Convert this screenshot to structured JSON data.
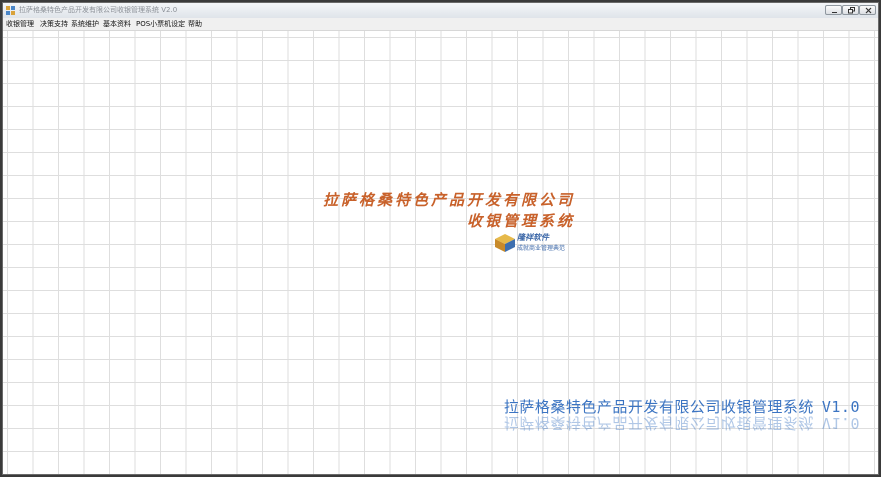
{
  "window": {
    "title": "拉萨格桑特色产品开发有限公司收银管理系统 V2.0"
  },
  "menu": {
    "items": [
      {
        "label": "收银管理"
      },
      {
        "label": "决策支持"
      },
      {
        "label": "系统维护"
      },
      {
        "label": "基本资料"
      },
      {
        "label": "POS小票机设定"
      },
      {
        "label": "帮助"
      }
    ]
  },
  "splash": {
    "company_line": "拉萨格桑特色产品开发有限公司",
    "system_line": "收银管理系统",
    "vendor_name": "隆祥软件",
    "vendor_slogan": "成就商业管理典范"
  },
  "footer": {
    "title": "拉萨格桑特色产品开发有限公司收银管理系统",
    "version": "V1.0"
  },
  "colors": {
    "calligraphy": "#c8612a",
    "footer_blue": "#3b74c2",
    "grid_line": "#dedede"
  },
  "icons": {
    "app": "app-icon",
    "minimize": "minimize-icon",
    "restore": "restore-icon",
    "close": "close-icon",
    "vendor": "vendor-logo-icon"
  }
}
